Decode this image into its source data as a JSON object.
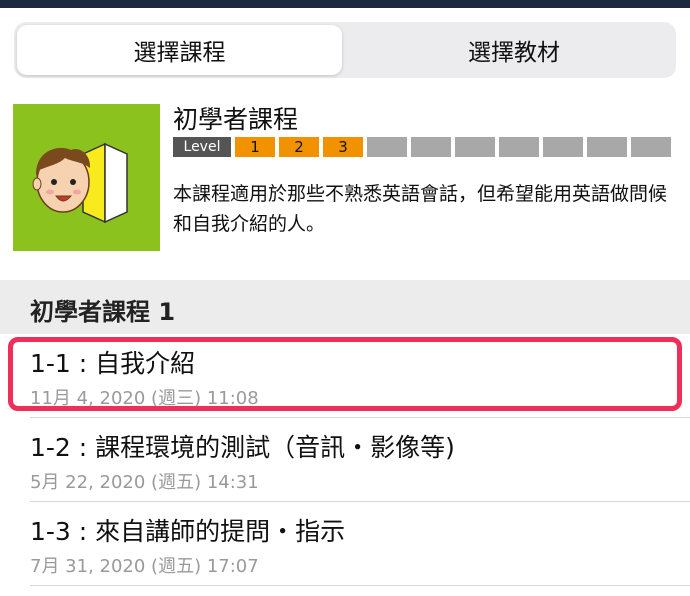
{
  "segment": {
    "active_label": "選擇課程",
    "inactive_label": "選擇教材"
  },
  "course": {
    "title": "初學者課程",
    "level_label": "Level",
    "levels": [
      "1",
      "2",
      "3"
    ],
    "level_slots": 10,
    "level_active_count": 3,
    "description": "本課程適用於那些不熟悉英語會話，但希望能用英語做問候和自我介紹的人。",
    "thumb_color": "#8cc21e"
  },
  "section": {
    "title": "初學者課程 1"
  },
  "lessons": [
    {
      "title": "1-1 : 自我介紹",
      "date": "11月 4, 2020 (週三) 11:08"
    },
    {
      "title": "1-2 : 課程環境的測試（音訊・影像等)",
      "date": "5月 22, 2020 (週五) 14:31"
    },
    {
      "title": "1-3 : 來自講師的提問・指示",
      "date": "7月 31, 2020 (週五) 17:07"
    }
  ],
  "colors": {
    "accent_orange": "#f39200",
    "highlight": "#ef2e5a",
    "header_bar": "#1c2840"
  }
}
